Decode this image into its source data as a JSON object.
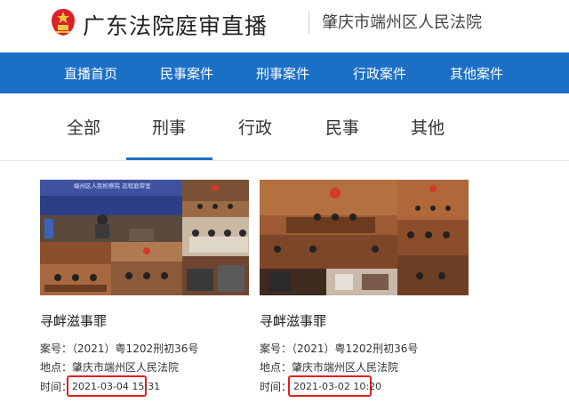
{
  "header": {
    "site_title": "广东法院庭审直播",
    "court_name": "肇庆市端州区人民法院"
  },
  "nav": {
    "items": [
      {
        "label": "直播首页"
      },
      {
        "label": "民事案件"
      },
      {
        "label": "刑事案件"
      },
      {
        "label": "行政案件"
      },
      {
        "label": "其他案件"
      }
    ]
  },
  "tabs": {
    "items": [
      {
        "label": "全部"
      },
      {
        "label": "刑事"
      },
      {
        "label": "行政"
      },
      {
        "label": "民事"
      },
      {
        "label": "其他"
      }
    ],
    "active": "刑事"
  },
  "labels": {
    "case_no": "案号：",
    "location": "地点：",
    "time": "时间："
  },
  "cards": [
    {
      "title": "寻衅滋事罪",
      "case_no": "（2021）粤1202刑初36号",
      "location": "肇庆市端州区人民法院",
      "time": "2021-03-04 15:31",
      "thumb_banner": "端州区人民检察院 远程庭审室"
    },
    {
      "title": "寻衅滋事罪",
      "case_no": "（2021）粤1202刑初36号",
      "location": "肇庆市端州区人民法院",
      "time": "2021-03-02 10:20"
    }
  ],
  "colors": {
    "nav_bg": "#1b6fc5",
    "highlight_border": "#e02020",
    "emblem": "#d8232a"
  }
}
